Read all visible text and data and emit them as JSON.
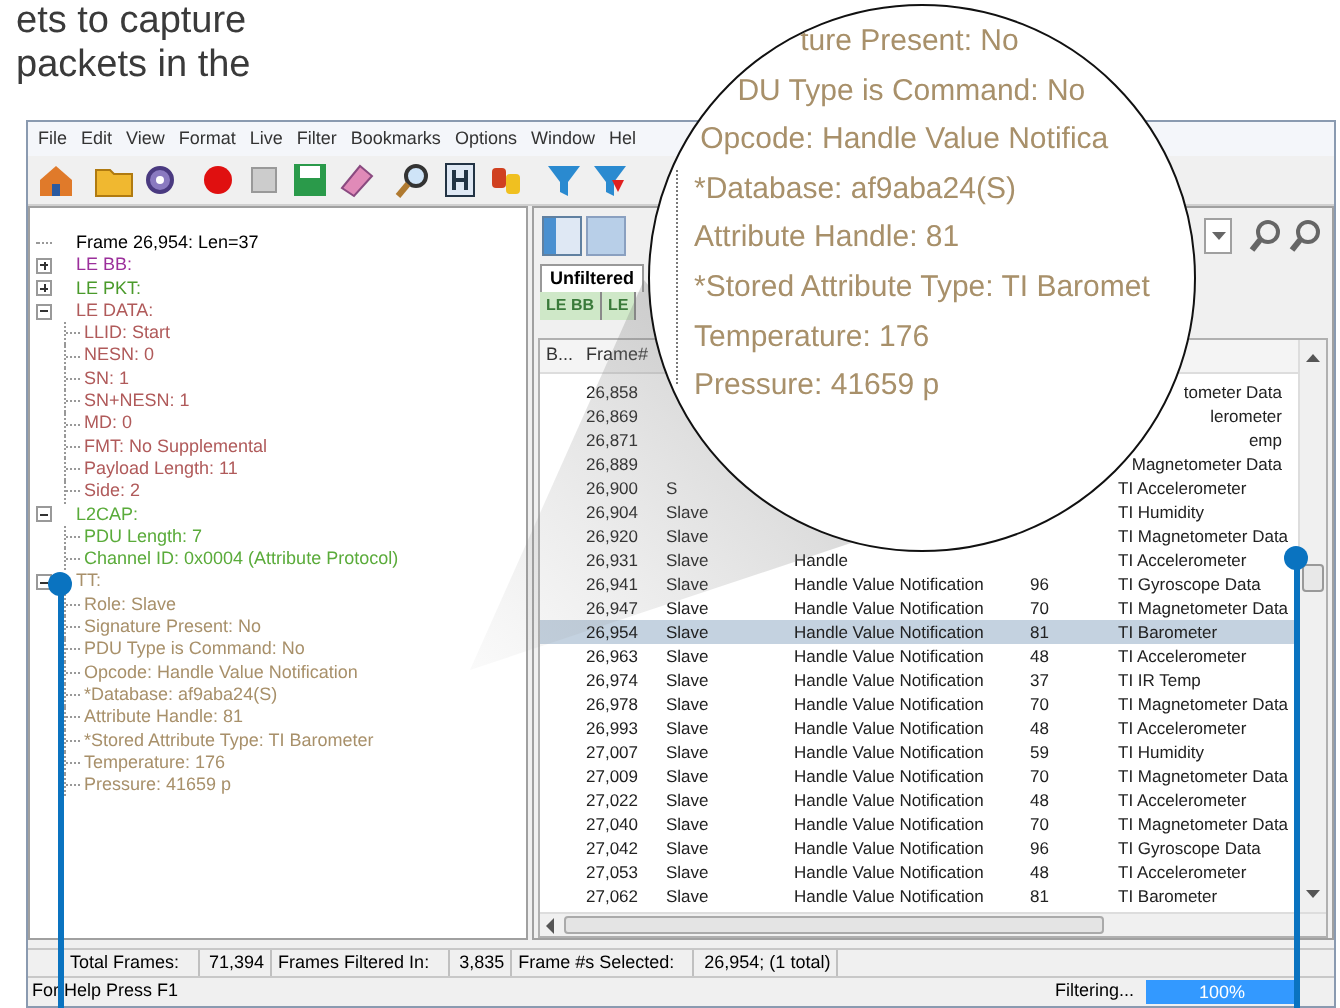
{
  "document_text": [
    "ets to capture",
    "packets in the"
  ],
  "menu": [
    "File",
    "Edit",
    "View",
    "Format",
    "Live",
    "Filter",
    "Bookmarks",
    "Options",
    "Window",
    "Hel"
  ],
  "tree": [
    {
      "label": "Frame 26,954:  Len=37",
      "color": "#000000"
    },
    {
      "label": "LE BB:",
      "color": "#9b2f9b",
      "expanded": false
    },
    {
      "label": "LE PKT:",
      "color": "#4a9a2a",
      "expanded": false
    },
    {
      "label": "LE DATA:",
      "color": "#b05a5a",
      "expanded": true,
      "children": [
        {
          "label": "LLID: Start"
        },
        {
          "label": "NESN: 0"
        },
        {
          "label": "SN: 1"
        },
        {
          "label": "SN+NESN: 1"
        },
        {
          "label": "MD: 0"
        },
        {
          "label": "FMT: No Supplemental"
        },
        {
          "label": "Payload Length: 11"
        },
        {
          "label": "Side: 2"
        }
      ]
    },
    {
      "label": "L2CAP:",
      "color": "#5aab3a",
      "expanded": true,
      "children": [
        {
          "label": "PDU Length: 7"
        },
        {
          "label": "Channel ID: 0x0004  (Attribute Protocol)"
        }
      ]
    },
    {
      "label": "TT:",
      "color": "#a8906a",
      "expanded": true,
      "children": [
        {
          "label": "Role: Slave"
        },
        {
          "label": "Signature Present: No"
        },
        {
          "label": "PDU Type is Command: No"
        },
        {
          "label": "Opcode: Handle Value Notification"
        },
        {
          "label": "*Database: af9aba24(S)"
        },
        {
          "label": "Attribute Handle: 81"
        },
        {
          "label": "*Stored Attribute Type: TI Barometer"
        },
        {
          "label": "Temperature: 176"
        },
        {
          "label": "Pressure: 41659 p"
        }
      ]
    }
  ],
  "view_tabs": [
    {
      "label": "Unfiltered",
      "selected": true
    }
  ],
  "protocol_tabs": [
    "LE BB",
    "LE"
  ],
  "table": {
    "columns": [
      "B...",
      "Frame#"
    ],
    "rows": [
      {
        "frame": "26,858",
        "type": "tometer Data",
        "selected": false
      },
      {
        "frame": "26,869",
        "type": "lerometer",
        "selected": false
      },
      {
        "frame": "26,871",
        "type": "emp",
        "selected": false
      },
      {
        "frame": "26,889",
        "type": "Magnetometer Data",
        "selected": false
      },
      {
        "frame": "26,900",
        "role": "S",
        "type": "TI Accelerometer",
        "selected": false
      },
      {
        "frame": "26,904",
        "role": "Slave",
        "type": "TI Humidity",
        "selected": false
      },
      {
        "frame": "26,920",
        "role": "Slave",
        "type": "TI Magnetometer Data",
        "selected": false
      },
      {
        "frame": "26,931",
        "role": "Slave",
        "opcode": "Handle",
        "type": "TI Accelerometer",
        "selected": false
      },
      {
        "frame": "26,941",
        "role": "Slave",
        "opcode": "Handle Value Notification",
        "handle": "96",
        "type": "TI Gyroscope Data",
        "selected": false
      },
      {
        "frame": "26,947",
        "role": "Slave",
        "opcode": "Handle Value Notification",
        "handle": "70",
        "type": "TI Magnetometer Data",
        "selected": false
      },
      {
        "frame": "26,954",
        "role": "Slave",
        "opcode": "Handle Value Notification",
        "handle": "81",
        "type": "TI Barometer",
        "selected": true
      },
      {
        "frame": "26,963",
        "role": "Slave",
        "opcode": "Handle Value Notification",
        "handle": "48",
        "type": "TI Accelerometer",
        "selected": false
      },
      {
        "frame": "26,974",
        "role": "Slave",
        "opcode": "Handle Value Notification",
        "handle": "37",
        "type": "TI IR Temp",
        "selected": false
      },
      {
        "frame": "26,978",
        "role": "Slave",
        "opcode": "Handle Value Notification",
        "handle": "70",
        "type": "TI Magnetometer Data",
        "selected": false
      },
      {
        "frame": "26,993",
        "role": "Slave",
        "opcode": "Handle Value Notification",
        "handle": "48",
        "type": "TI Accelerometer",
        "selected": false
      },
      {
        "frame": "27,007",
        "role": "Slave",
        "opcode": "Handle Value Notification",
        "handle": "59",
        "type": "TI Humidity",
        "selected": false
      },
      {
        "frame": "27,009",
        "role": "Slave",
        "opcode": "Handle Value Notification",
        "handle": "70",
        "type": "TI Magnetometer Data",
        "selected": false
      },
      {
        "frame": "27,022",
        "role": "Slave",
        "opcode": "Handle Value Notification",
        "handle": "48",
        "type": "TI Accelerometer",
        "selected": false
      },
      {
        "frame": "27,040",
        "role": "Slave",
        "opcode": "Handle Value Notification",
        "handle": "70",
        "type": "TI Magnetometer Data",
        "selected": false
      },
      {
        "frame": "27,042",
        "role": "Slave",
        "opcode": "Handle Value Notification",
        "handle": "96",
        "type": "TI Gyroscope Data",
        "selected": false
      },
      {
        "frame": "27,053",
        "role": "Slave",
        "opcode": "Handle Value Notification",
        "handle": "48",
        "type": "TI Accelerometer",
        "selected": false
      },
      {
        "frame": "27,062",
        "role": "Slave",
        "opcode": "Handle Value Notification",
        "handle": "81",
        "type": "TI Barometer",
        "selected": false
      }
    ]
  },
  "status_panes": [
    {
      "label": "Total Frames:",
      "value": "71,394"
    },
    {
      "label": "Frames Filtered In:",
      "value": "3,835"
    },
    {
      "label": "Frame #s Selected:",
      "value": "26,954; (1 total)"
    }
  ],
  "status_bar": {
    "help": "For Help Press F1",
    "filter_label": "Filtering...",
    "progress": {
      "level": 1,
      "text": "100%"
    }
  },
  "magnifier": {
    "lines": [
      "ture Present: No",
      "DU Type is Command: No",
      "Opcode: Handle Value Notifica",
      "*Database: af9aba24(S)",
      "Attribute Handle: 81",
      "*Stored Attribute Type: TI Baromet",
      "Temperature: 176",
      "Pressure: 41659 p"
    ]
  }
}
